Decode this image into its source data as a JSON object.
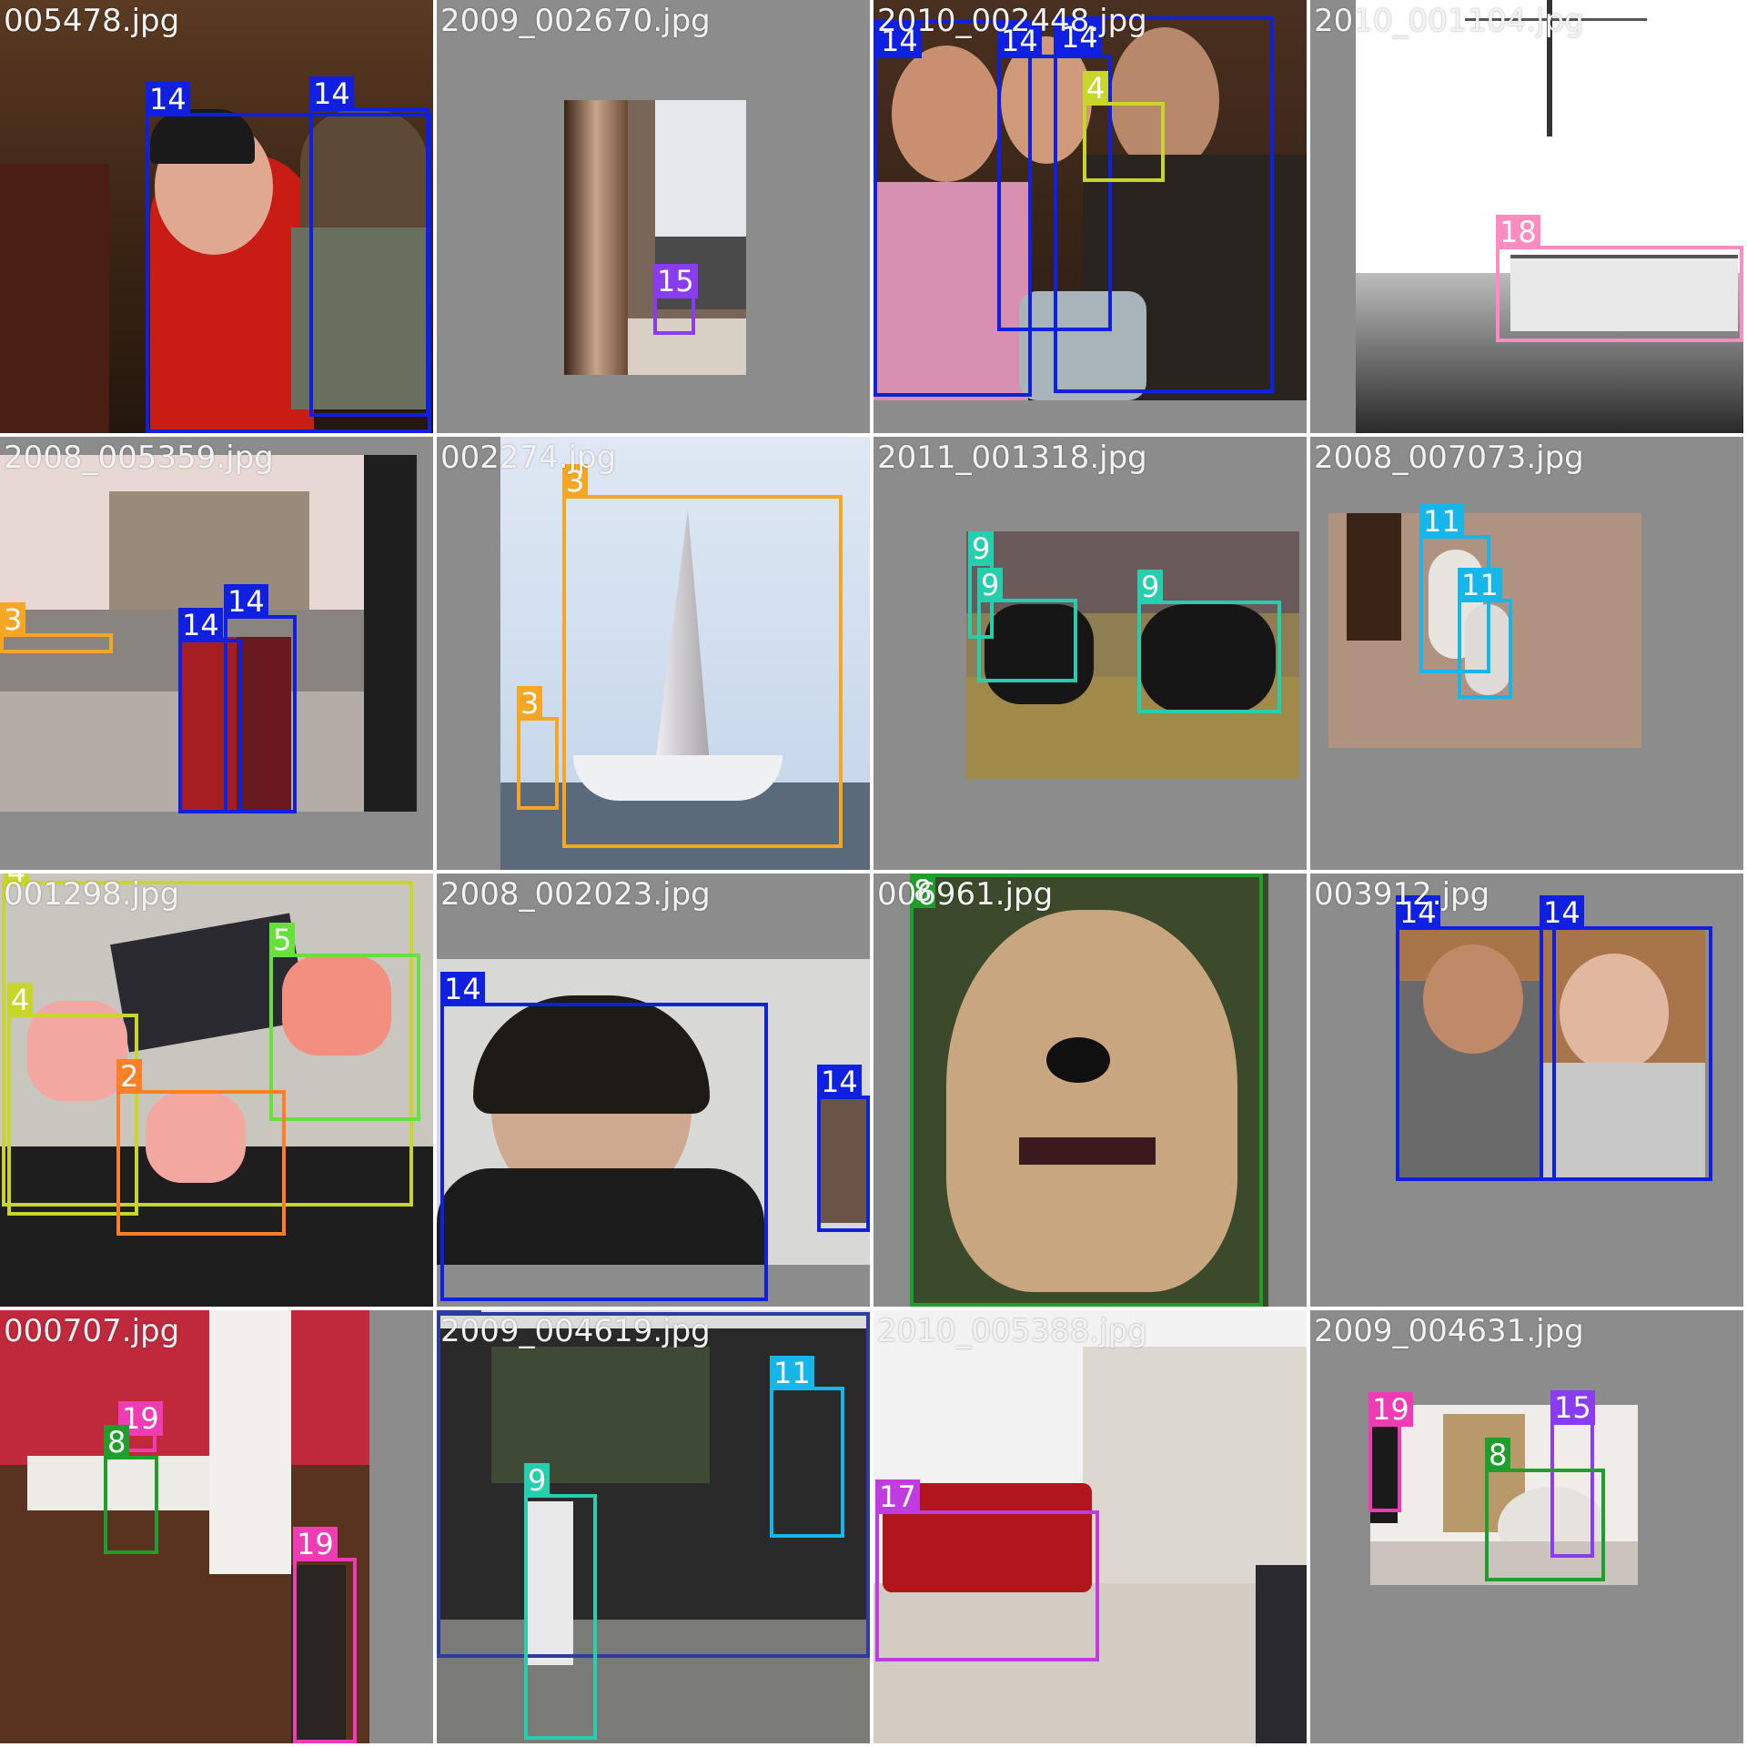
{
  "grid": {
    "rows": 4,
    "cols": 4,
    "background": "#8c8c8c"
  },
  "class_colors": {
    "2": "#ff7f27",
    "3": "#f5a623",
    "4": "#c8d62b",
    "5": "#66e03a",
    "8": "#1f9e2c",
    "9": "#25cfae",
    "11": "#16b7e8",
    "12": "#2d3d9e",
    "14": "#1020e0",
    "15": "#8a3cf0",
    "17": "#c03ce0",
    "18": "#ff8cc0",
    "19": "#f03cb4"
  },
  "tiles": [
    {
      "filename": "005478.jpg",
      "scene": "dark living room with man in red turtleneck and boy",
      "boxes": [
        {
          "class_label": "14"
        },
        {
          "class_label": "14"
        }
      ]
    },
    {
      "filename": "2009_002670.jpg",
      "scene": "window with curtain and small flower pot",
      "boxes": [
        {
          "class_label": "15"
        }
      ]
    },
    {
      "filename": "2010_002448.jpg",
      "scene": "three women with drinks at a party",
      "boxes": [
        {
          "class_label": "14"
        },
        {
          "class_label": "14"
        },
        {
          "class_label": "14"
        },
        {
          "class_label": "4"
        }
      ]
    },
    {
      "filename": "2010_001104.jpg",
      "scene": "black and white railway with tank wagons",
      "boxes": [
        {
          "class_label": "18"
        }
      ]
    },
    {
      "filename": "2008_005359.jpg",
      "scene": "couple in front of Tower Bridge",
      "boxes": [
        {
          "class_label": "3"
        },
        {
          "class_label": "14"
        },
        {
          "class_label": "14"
        }
      ]
    },
    {
      "filename": "002274.jpg",
      "scene": "sailboat on water under clear sky",
      "boxes": [
        {
          "class_label": "3"
        },
        {
          "class_label": "3"
        }
      ]
    },
    {
      "filename": "2011_001318.jpg",
      "scene": "black cows resting on hay in a stable",
      "boxes": [
        {
          "class_label": "9"
        },
        {
          "class_label": "9"
        },
        {
          "class_label": "9"
        }
      ]
    },
    {
      "filename": "2008_007073.jpg",
      "scene": "two husky puppies on carpet near table leg",
      "boxes": [
        {
          "class_label": "11"
        },
        {
          "class_label": "11"
        }
      ]
    },
    {
      "filename": "001298.jpg",
      "scene": "people in life vests climbing a boat ladder",
      "boxes": [
        {
          "class_label": "4"
        },
        {
          "class_label": "4"
        },
        {
          "class_label": "5"
        },
        {
          "class_label": "2"
        }
      ]
    },
    {
      "filename": "2008_002023.jpg",
      "scene": "smiling man with sunglasses at outdoor cafe",
      "boxes": [
        {
          "class_label": "14"
        },
        {
          "class_label": "14"
        },
        {
          "class_label": "12"
        }
      ]
    },
    {
      "filename": "006961.jpg",
      "scene": "close-up of a tan dog with collar",
      "boxes": [
        {
          "class_label": "8"
        }
      ]
    },
    {
      "filename": "003912.jpg",
      "scene": "couple taking a selfie",
      "boxes": [
        {
          "class_label": "14"
        },
        {
          "class_label": "14"
        }
      ]
    },
    {
      "filename": "000707.jpg",
      "scene": "red room with chair, desk and tv",
      "boxes": [
        {
          "class_label": "19"
        },
        {
          "class_label": "8"
        },
        {
          "class_label": "19"
        }
      ]
    },
    {
      "filename": "2009_004619.jpg",
      "scene": "man standing in front of steam locomotive 29",
      "boxes": [
        {
          "class_label": "11"
        },
        {
          "class_label": "9"
        }
      ]
    },
    {
      "filename": "2010_005388.jpg",
      "scene": "red sofa in a white room with curtains",
      "boxes": [
        {
          "class_label": "17"
        }
      ]
    },
    {
      "filename": "2009_004631.jpg",
      "scene": "living room with shelves, speaker and egg chair",
      "boxes": [
        {
          "class_label": "19"
        },
        {
          "class_label": "15"
        },
        {
          "class_label": "8"
        }
      ]
    }
  ]
}
